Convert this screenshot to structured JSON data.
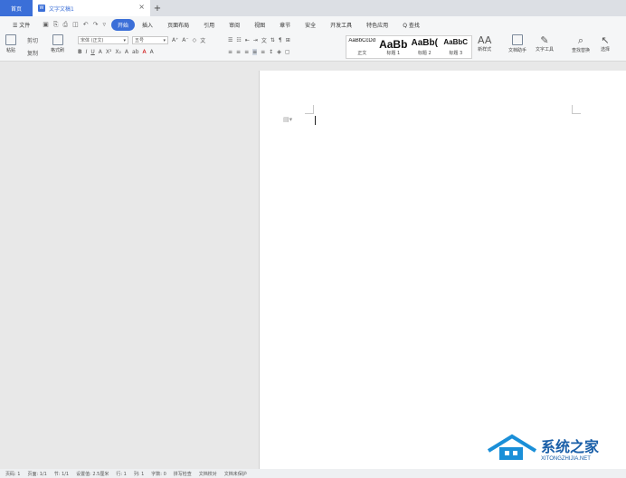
{
  "tabs": {
    "home": "首页",
    "doc_title": "文字文稿1",
    "close": "×",
    "add": "+"
  },
  "menu": {
    "file": "☰ 文件",
    "items": [
      "开始",
      "插入",
      "页面布局",
      "引用",
      "审阅",
      "视图",
      "章节",
      "安全",
      "开发工具",
      "特色应用"
    ],
    "search": "Q 查找"
  },
  "ribbon": {
    "paste": "粘贴",
    "cut": "剪切",
    "copy": "复制",
    "format_painter": "格式刷",
    "font_name": "宋体 (正文)",
    "font_size": "五号",
    "styles": [
      {
        "sample": "AaBbCcDd",
        "name": "正文"
      },
      {
        "sample": "AaBb",
        "name": "标题 1"
      },
      {
        "sample": "AaBb(",
        "name": "标题 2"
      },
      {
        "sample": "AaBbC",
        "name": "标题 3"
      }
    ],
    "new_style": "新样式",
    "doc_assistant": "文档助手",
    "text_tools": "文字工具",
    "find_replace": "查找替换",
    "select": "选择"
  },
  "status": [
    "页码: 1",
    "页面: 1/1",
    "节: 1/1",
    "设置值: 2.5厘米",
    "行: 1",
    "列: 1",
    "字数: 0",
    "拼写检查",
    "文档校对",
    "文档未保护"
  ],
  "watermark": {
    "brand": "系统之家",
    "url": "XITONGZHIJIA.NET"
  }
}
